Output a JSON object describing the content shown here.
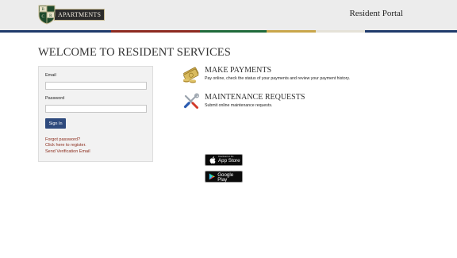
{
  "header": {
    "logo": {
      "letters": [
        "B",
        "R",
        "C"
      ],
      "banner_text": "APARTMENTS"
    },
    "portal_title": "Resident Portal",
    "stripe_colors": [
      "#1f3a6b",
      "#8d2a20",
      "#1f6a3a",
      "#c9a64a",
      "#e5e2d8",
      "#1f3a6b"
    ]
  },
  "main": {
    "heading": "WELCOME TO RESIDENT SERVICES"
  },
  "login": {
    "email_label": "Email",
    "email_value": "",
    "password_label": "Password",
    "password_value": "",
    "sign_in_label": "Sign In",
    "links": [
      "Forgot password?",
      "Click here to register.",
      "Send Verification Email"
    ]
  },
  "services": [
    {
      "icon": "money-icon",
      "title": "MAKE PAYMENTS",
      "description": "Pay online, check the status of your payments and review your payment history."
    },
    {
      "icon": "tools-icon",
      "title": "MAINTENANCE REQUESTS",
      "description": "Submit online maintenance requests."
    }
  ],
  "app_badges": [
    {
      "icon": "apple-icon",
      "small_text": "Download on the",
      "big_text": "App Store"
    },
    {
      "icon": "google-play-icon",
      "small_text": "ANDROID APP ON",
      "big_text": "Google Play"
    }
  ]
}
